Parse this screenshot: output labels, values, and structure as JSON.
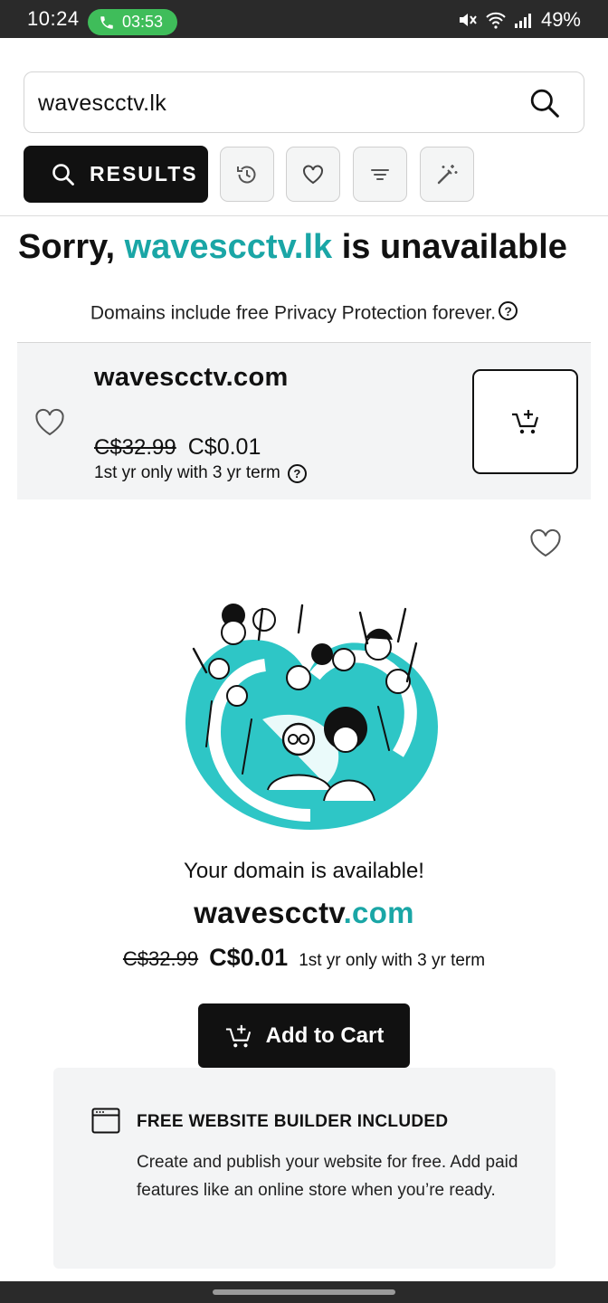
{
  "status_bar": {
    "time": "10:24",
    "call_timer": "03:53",
    "battery": "49%",
    "icons": [
      "phone-icon",
      "mute-icon",
      "wifi-icon",
      "signal-icon"
    ]
  },
  "search": {
    "value": "wavescctv.lk",
    "icon": "search-icon"
  },
  "toolbar": {
    "results_label": "RESULTS",
    "buttons": [
      "history-icon",
      "heart-icon",
      "filter-icon",
      "magic-wand-icon"
    ]
  },
  "headline": {
    "prefix": "Sorry, ",
    "domain": "wavescctv.lk",
    "suffix": " is unavailable",
    "accent_color": "#1aa6a6"
  },
  "privacy_note": "Domains include free Privacy Protection forever.",
  "result_card": {
    "domain": "wavescctv.com",
    "old_price": "C$32.99",
    "new_price": "C$0.01",
    "term": "1st yr only with 3 yr term"
  },
  "promo": {
    "available_text": "Your domain is available!",
    "domain_name": "wavescctv",
    "domain_tld": ".com",
    "old_price": "C$32.99",
    "new_price": "C$0.01",
    "term": "1st yr only with 3 yr term",
    "add_to_cart_label": "Add to Cart"
  },
  "builder": {
    "title": "FREE WEBSITE BUILDER INCLUDED",
    "body": "Create and publish your website for free. Add paid features like an online store when you’re ready."
  },
  "colors": {
    "accent_teal": "#1aa6a6",
    "illustration_teal": "#2ec6c6",
    "primary_black": "#111111"
  }
}
